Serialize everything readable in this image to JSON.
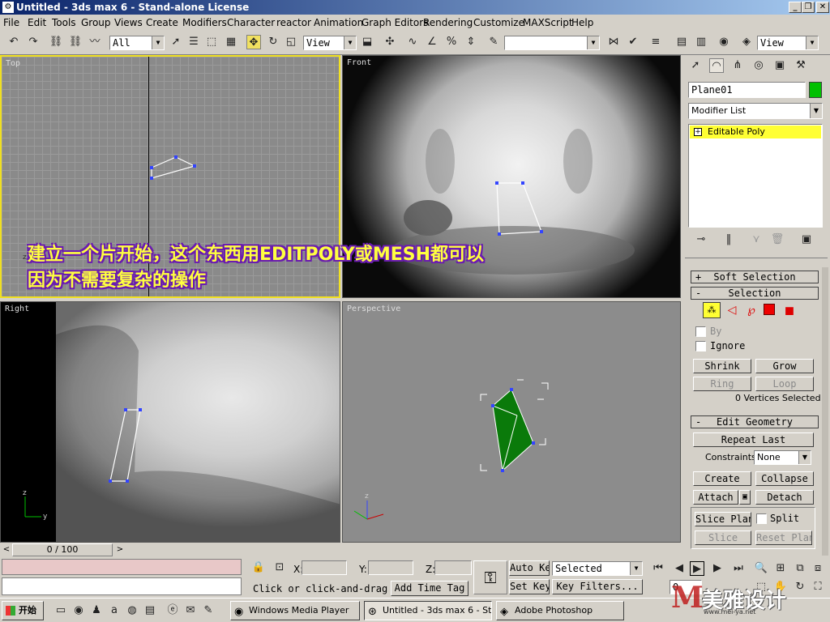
{
  "window": {
    "title": "Untitled - 3ds max 6 - Stand-alone License"
  },
  "menu": [
    "File",
    "Edit",
    "Tools",
    "Group",
    "Views",
    "Create",
    "Modifiers",
    "Character",
    "reactor",
    "Animation",
    "Graph Editors",
    "Rendering",
    "Customize",
    "MAXScript",
    "Help"
  ],
  "toolbar": {
    "selection_filter": "All",
    "ref_coord": "View",
    "named_selection": "",
    "render_view": "View"
  },
  "viewports": {
    "top": {
      "label": "Top"
    },
    "front": {
      "label": "Front"
    },
    "right": {
      "label": "Right"
    },
    "perspective": {
      "label": "Perspective"
    }
  },
  "caption": {
    "line1": "建立一个片开始，这个东西用EDITPOLY或MESH都可以",
    "line2": "因为不需要复杂的操作"
  },
  "command_panel": {
    "object_name": "Plane01",
    "object_color": "#00c000",
    "modifier_list": "Modifier List",
    "stack_item": "Editable Poly",
    "rollouts": {
      "soft_selection": "Soft Selection",
      "selection": "Selection",
      "edit_geometry": "Edit Geometry"
    },
    "by_label": "By",
    "ignore_label": "Ignore",
    "shrink": "Shrink",
    "grow": "Grow",
    "ring": "Ring",
    "loop": "Loop",
    "selection_status": "0 Vertices Selected",
    "repeat_last": "Repeat Last",
    "constraints_label": "Constraints:",
    "constraints_value": "None",
    "create": "Create",
    "collapse": "Collapse",
    "attach": "Attach",
    "detach": "Detach",
    "slice_plane": "Slice Plane",
    "split": "Split",
    "slice": "Slice",
    "reset_plane": "Reset Plane"
  },
  "timeline": {
    "frame": "0 / 100"
  },
  "status": {
    "coord_x": "X:",
    "coord_y": "Y:",
    "coord_z": "Z:",
    "prompt": "Click or click-and-drag",
    "add_time_tag": "Add Time Tag",
    "auto_key": "Auto Key",
    "set_key": "Set Key",
    "key_mode": "Selected",
    "key_filters": "Key Filters...",
    "frame_field": "0"
  },
  "taskbar": {
    "start": "开始",
    "tasks": [
      "Windows Media Player",
      "Untitled - 3ds max 6 - St...",
      "Adobe Photoshop"
    ],
    "watermark": "美雅设计",
    "watermark_url": "www.mei-ya.net"
  }
}
